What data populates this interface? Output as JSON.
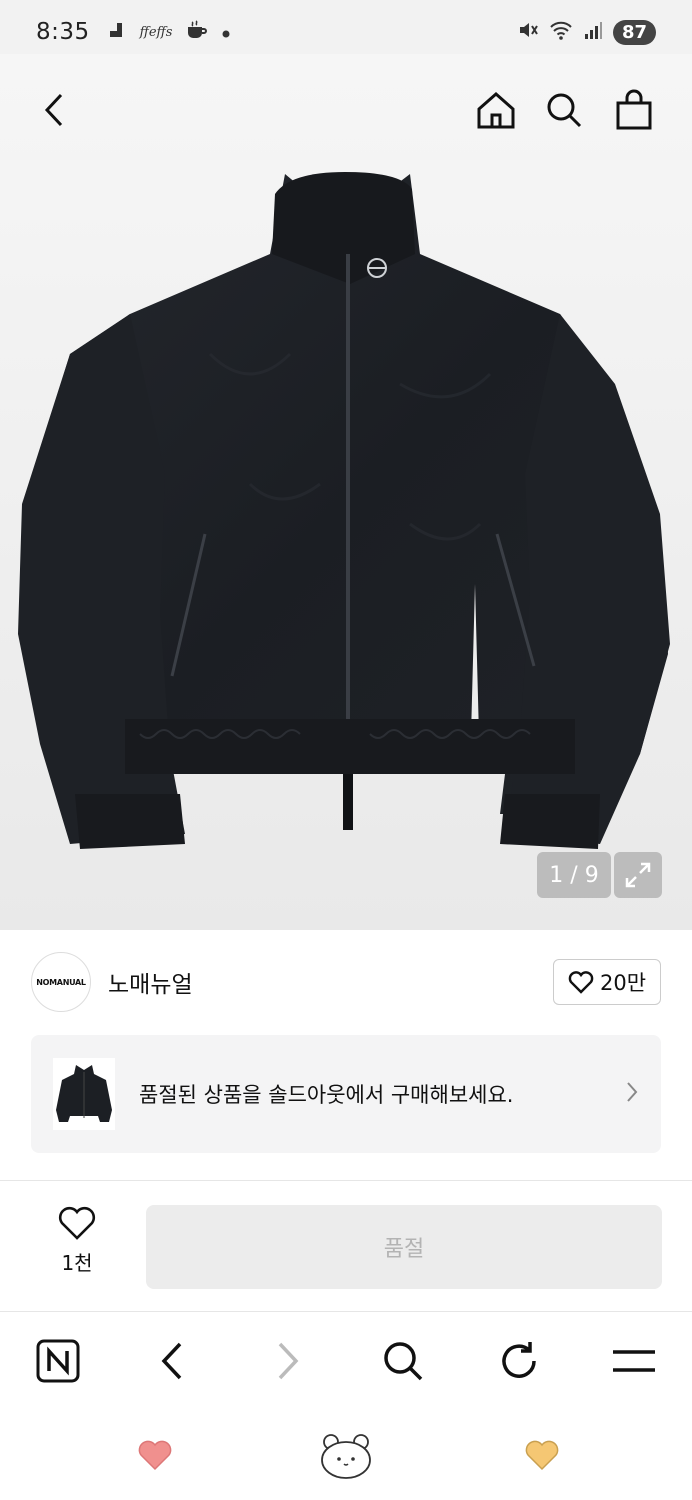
{
  "status_bar": {
    "time": "8:35",
    "notif_text": "ffeffs",
    "battery": "87"
  },
  "product": {
    "image_alt": "black nylon zip-up track jacket",
    "image_counter": "1 / 9"
  },
  "brand": {
    "logo_text": "NOMANUAL",
    "name": "노매뉴얼",
    "likes": "20만"
  },
  "banner": {
    "text": "품절된 상품을 솔드아웃에서 구매해보세요."
  },
  "action_bar": {
    "wish_count": "1천",
    "buy_label": "품절"
  },
  "colors": {
    "accent_heart": "#f0908e",
    "yellow_heart": "#f5c773",
    "sold_out_bg": "#ececec"
  }
}
